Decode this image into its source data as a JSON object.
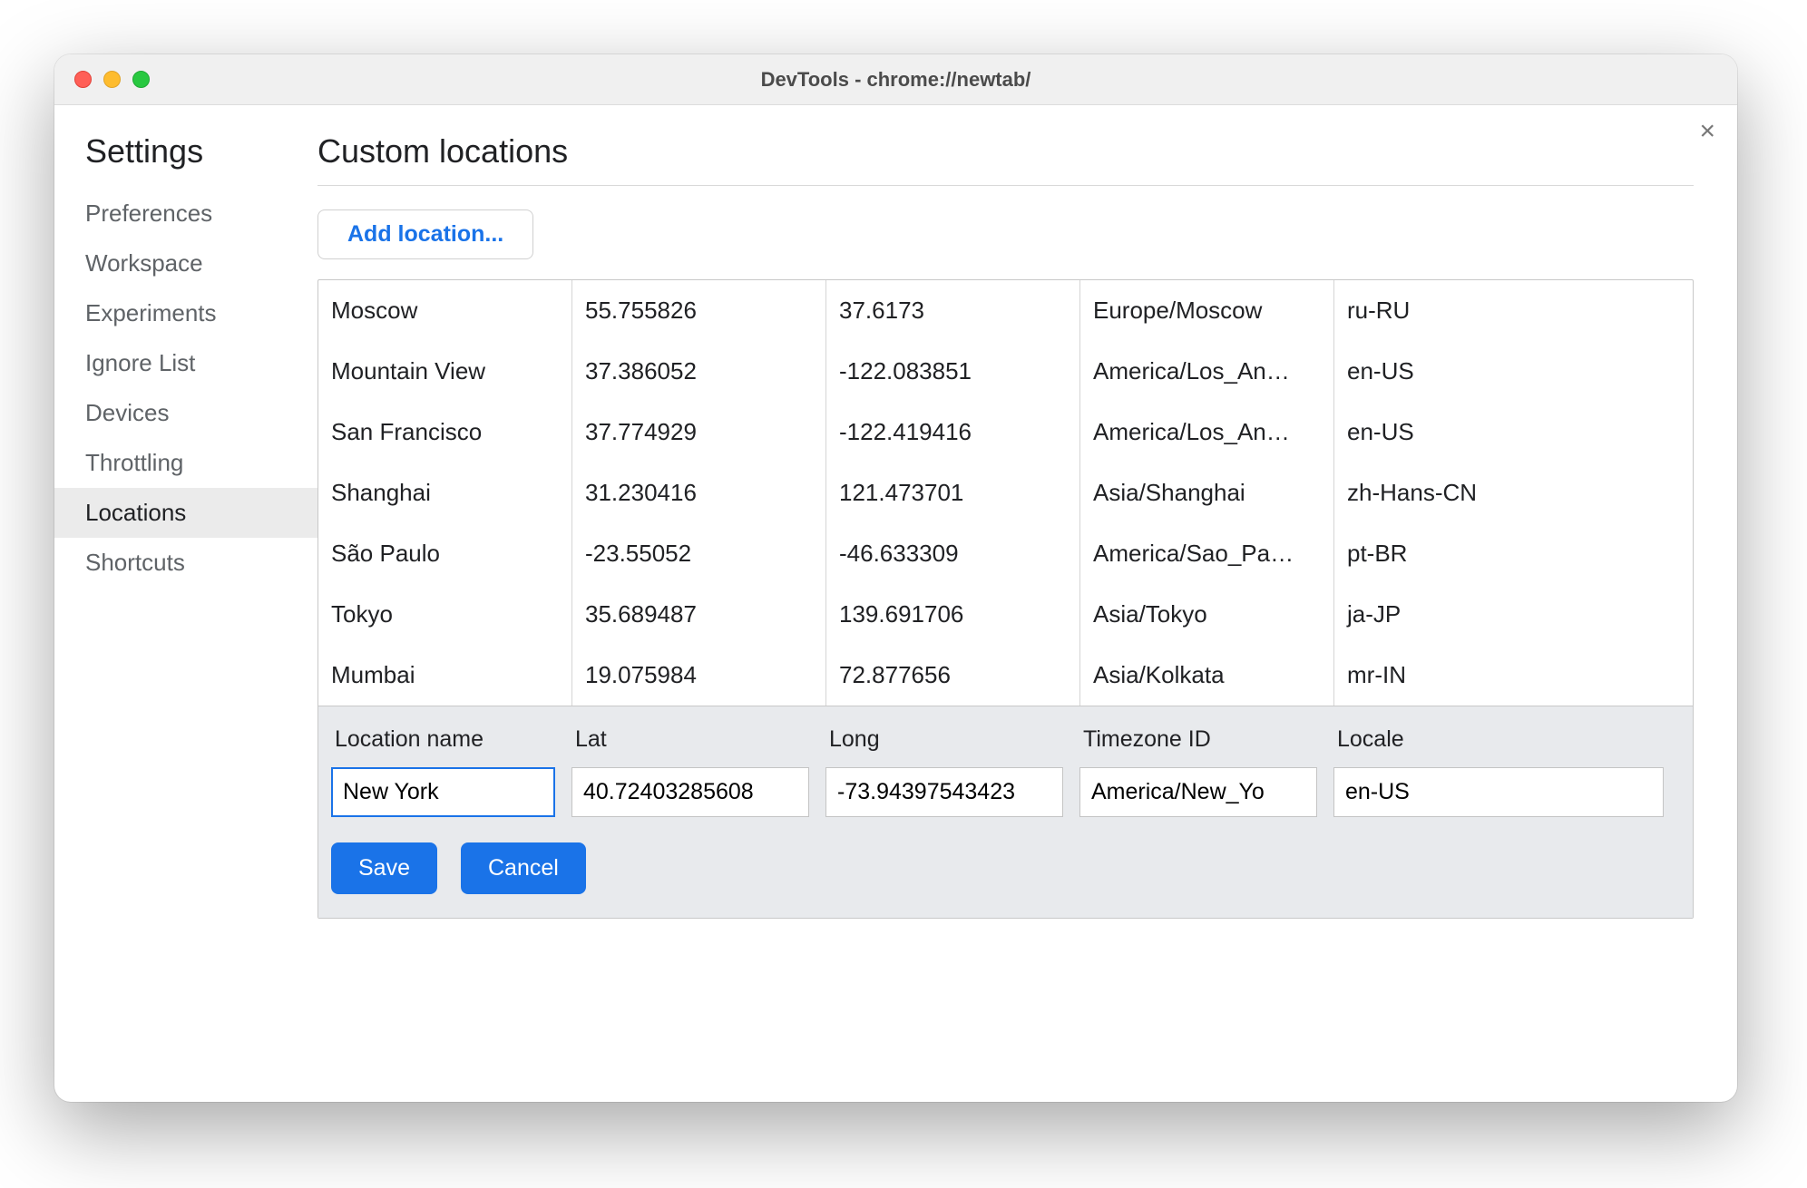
{
  "window": {
    "title": "DevTools - chrome://newtab/"
  },
  "close_glyph": "×",
  "sidebar": {
    "title": "Settings",
    "items": [
      "Preferences",
      "Workspace",
      "Experiments",
      "Ignore List",
      "Devices",
      "Throttling",
      "Locations",
      "Shortcuts"
    ],
    "active_index": 6
  },
  "main": {
    "title": "Custom locations",
    "add_button_label": "Add location...",
    "rows": [
      {
        "name": "Moscow",
        "lat": "55.755826",
        "lon": "37.6173",
        "tz": "Europe/Moscow",
        "locale": "ru-RU"
      },
      {
        "name": "Mountain View",
        "lat": "37.386052",
        "lon": "-122.083851",
        "tz": "America/Los_An…",
        "locale": "en-US"
      },
      {
        "name": "San Francisco",
        "lat": "37.774929",
        "lon": "-122.419416",
        "tz": "America/Los_An…",
        "locale": "en-US"
      },
      {
        "name": "Shanghai",
        "lat": "31.230416",
        "lon": "121.473701",
        "tz": "Asia/Shanghai",
        "locale": "zh-Hans-CN"
      },
      {
        "name": "São Paulo",
        "lat": "-23.55052",
        "lon": "-46.633309",
        "tz": "America/Sao_Pa…",
        "locale": "pt-BR"
      },
      {
        "name": "Tokyo",
        "lat": "35.689487",
        "lon": "139.691706",
        "tz": "Asia/Tokyo",
        "locale": "ja-JP"
      },
      {
        "name": "Mumbai",
        "lat": "19.075984",
        "lon": "72.877656",
        "tz": "Asia/Kolkata",
        "locale": "mr-IN"
      }
    ],
    "editor": {
      "headers": {
        "name": "Location name",
        "lat": "Lat",
        "lon": "Long",
        "tz": "Timezone ID",
        "locale": "Locale"
      },
      "values": {
        "name": "New York",
        "lat": "40.72403285608",
        "lon": "-73.94397543423",
        "tz": "America/New_Yo",
        "locale": "en-US"
      },
      "save_label": "Save",
      "cancel_label": "Cancel"
    }
  }
}
